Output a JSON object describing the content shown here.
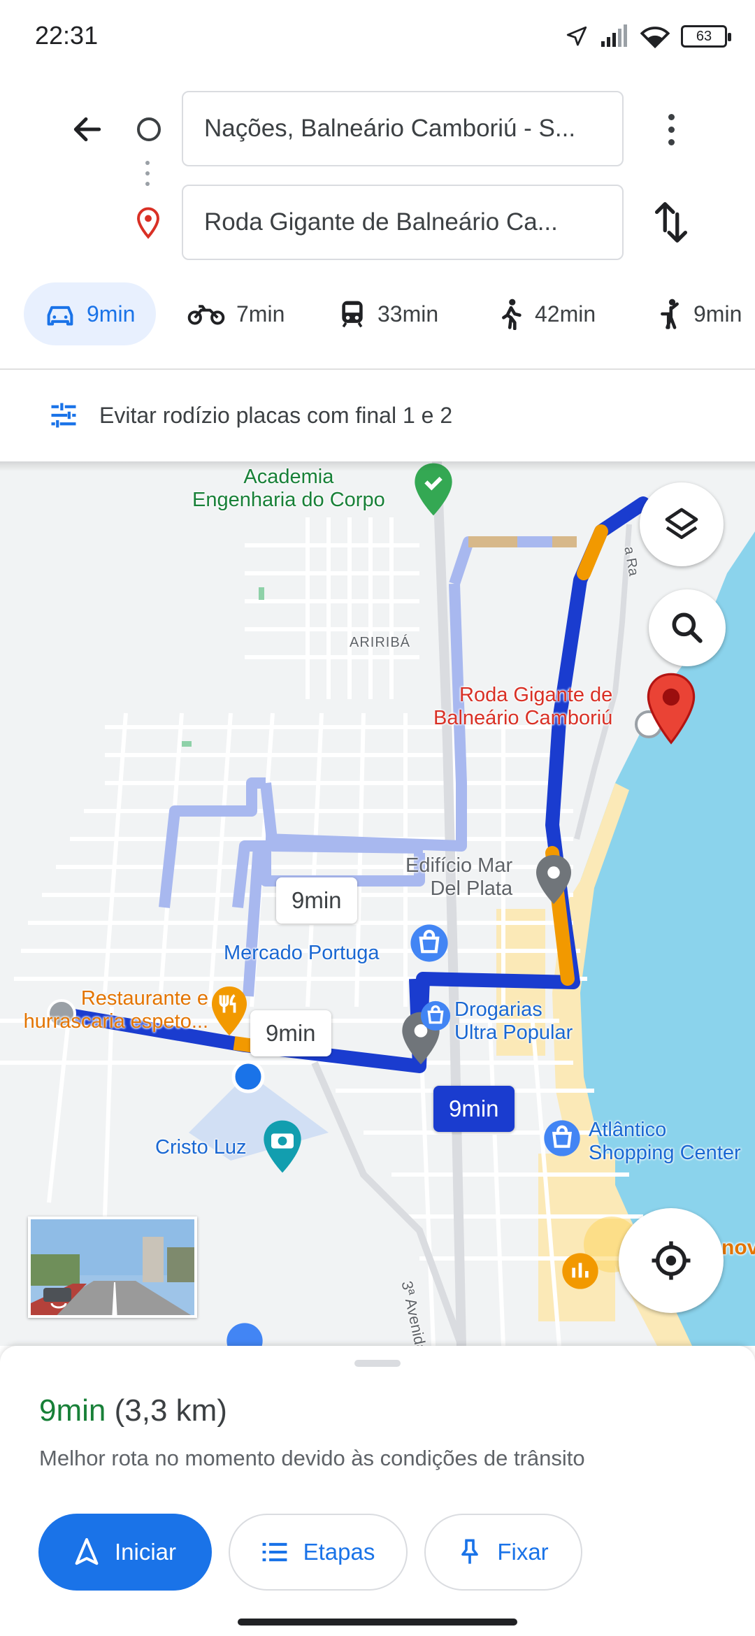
{
  "status_bar": {
    "time": "22:31",
    "battery": "63"
  },
  "search": {
    "origin": "Nações, Balneário Camboriú - S...",
    "destination": "Roda Gigante de Balneário Ca..."
  },
  "modes": [
    {
      "icon": "car-icon",
      "label": "9min",
      "active": true
    },
    {
      "icon": "motorcycle-icon",
      "label": "7min"
    },
    {
      "icon": "transit-icon",
      "label": "33min"
    },
    {
      "icon": "walk-icon",
      "label": "42min"
    },
    {
      "icon": "ride-icon",
      "label": "9min"
    }
  ],
  "options": {
    "avoid_label": "Evitar rodízio placas com final 1 e 2"
  },
  "map": {
    "places": {
      "academia": "Academia\nEngenharia do Corpo",
      "neighborhood": "ARIRIBÁ",
      "destination": "Roda Gigante de\nBalneário Camboriú",
      "edificio": "Edifício Mar\nDel Plata",
      "mercado": "Mercado Portuga",
      "restaurante": "Restaurante e\nhurrascaria espeto...",
      "drogarias": "Drogarias\nUltra Popular",
      "cristo": "Cristo Luz",
      "atlantico": "Atlântico\nShopping Center",
      "avenida": "3ª Avenida",
      "road_fragment": "a Ra",
      "partial_right": "nov"
    },
    "route_times": {
      "alt_1": "9min",
      "alt_2": "9min",
      "selected": "9min"
    },
    "colors": {
      "route_main": "#1a3ccf",
      "route_alt": "#a8b8ef",
      "traffic_slow": "#f29900",
      "water": "#8bd3ec",
      "beach": "#fbe9b7"
    }
  },
  "sheet": {
    "duration": "9min",
    "distance": "(3,3 km)",
    "description": "Melhor rota no momento devido às condições de trânsito",
    "start_label": "Iniciar",
    "steps_label": "Etapas",
    "pin_label": "Fixar"
  }
}
